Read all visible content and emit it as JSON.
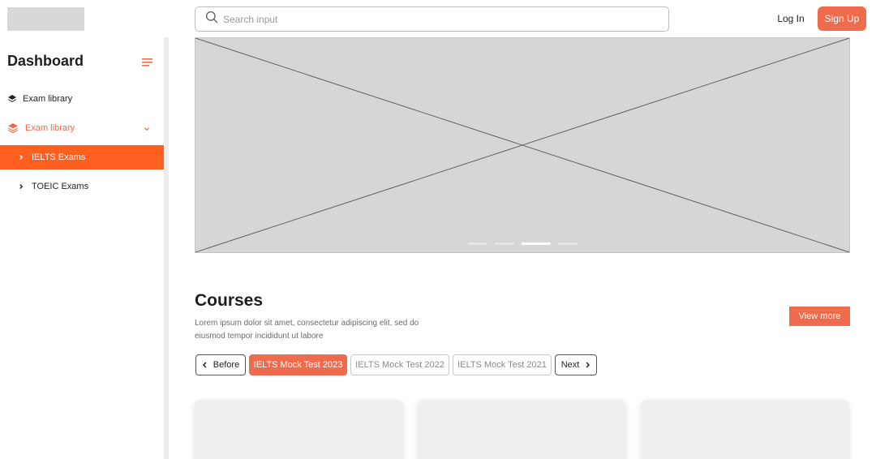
{
  "header": {
    "search_placeholder": "Search input",
    "login_label": "Log In",
    "signup_label": "Sign Up"
  },
  "sidebar": {
    "title": "Dashboard",
    "items": [
      {
        "label": "Exam library",
        "icon": "layers-icon"
      },
      {
        "label": "Exam library",
        "icon": "layers-icon",
        "expanded": true
      },
      {
        "label": "IELTS Exams",
        "active": true
      },
      {
        "label": "TOEIC Exams"
      }
    ]
  },
  "banner": {
    "slide_count": 4,
    "active_slide": 3
  },
  "courses": {
    "title": "Courses",
    "description": "Lorem ipsum dolor sit amet, consectetur adipiscing elit, sed do eiusmod tempor incididunt ut labore",
    "view_more_label": "View more",
    "before_label": "Before",
    "next_label": "Next",
    "tabs": [
      {
        "label": "IELTS Mock Test 2023",
        "active": true
      },
      {
        "label": "IELTS Mock Test 2022"
      },
      {
        "label": "IELTS Mock Test 2021"
      }
    ]
  },
  "colors": {
    "accent": "#ee6c4d",
    "active_nav": "#ff5f1f",
    "placeholder_gray": "#d6d6d6"
  }
}
